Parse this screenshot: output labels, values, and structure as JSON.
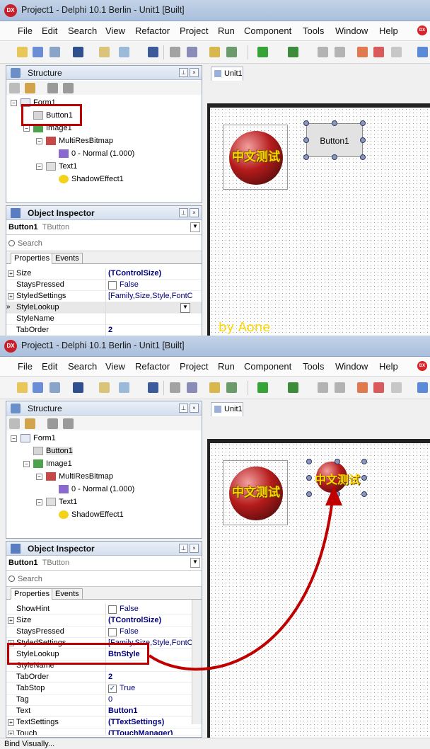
{
  "window_title": "Project1 - Delphi 10.1 Berlin - Unit1 [Built]",
  "dx_label": "DX",
  "menu": [
    "File",
    "Edit",
    "Search",
    "View",
    "Refactor",
    "Project",
    "Run",
    "Component",
    "Tools",
    "Window",
    "Help"
  ],
  "structure": {
    "title": "Structure",
    "tree": {
      "form": "Form1",
      "button": "Button1",
      "image": "Image1",
      "multiresbitmap": "MultiResBitmap",
      "bitmap_item": "0 - Normal (1.000)",
      "text": "Text1",
      "shadow": "ShadowEffect1"
    }
  },
  "designer": {
    "tab": "Unit1",
    "globe_text": "中文测试",
    "button_label": "Button1",
    "watermark": "by Aone"
  },
  "inspector": {
    "title": "Object Inspector",
    "selected_name": "Button1",
    "selected_type": "TButton",
    "search_placeholder": "Search",
    "tabs": [
      "Properties",
      "Events"
    ],
    "props_a": [
      {
        "name": "Size",
        "value": "(TControlSize)"
      },
      {
        "name": "StaysPressed",
        "value": "False"
      },
      {
        "name": "StyledSettings",
        "value": "[Family,Size,Style,FontC"
      },
      {
        "name": "StyleLookup",
        "value": ""
      },
      {
        "name": "StyleName",
        "value": ""
      },
      {
        "name": "TabOrder",
        "value": "2"
      }
    ],
    "props_b": [
      {
        "name": "ShowHint",
        "value": "False"
      },
      {
        "name": "Size",
        "value": "(TControlSize)"
      },
      {
        "name": "StaysPressed",
        "value": "False"
      },
      {
        "name": "StyledSettings",
        "value": "[Family,Size,Style,FontC"
      },
      {
        "name": "StyleLookup",
        "value": "BtnStyle"
      },
      {
        "name": "StyleName",
        "value": ""
      },
      {
        "name": "TabOrder",
        "value": "2"
      },
      {
        "name": "TabStop",
        "value": "True"
      },
      {
        "name": "Tag",
        "value": "0"
      },
      {
        "name": "Text",
        "value": "Button1"
      },
      {
        "name": "TextSettings",
        "value": "(TTextSettings)"
      },
      {
        "name": "Touch",
        "value": "(TTouchManager)"
      }
    ]
  },
  "status": "Bind Visually...",
  "colors": {
    "highlight": "#c00000",
    "title_bg": "#b8cbe4",
    "globe_text": "#ffd700"
  }
}
